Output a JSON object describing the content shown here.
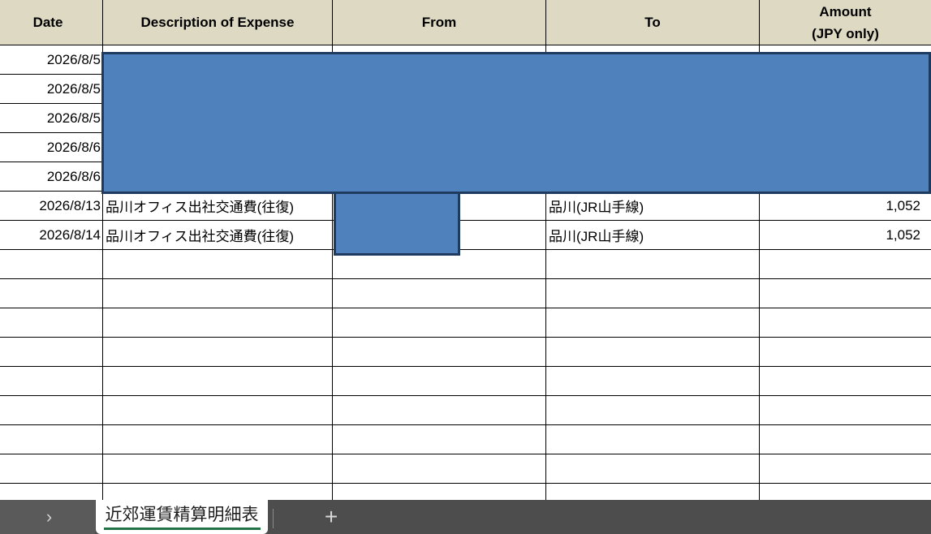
{
  "table": {
    "headers": {
      "date": "Date",
      "description": "Description of Expense",
      "from": "From",
      "to": "To",
      "amount_line1": "Amount",
      "amount_line2": "(JPY only)"
    },
    "rows": [
      {
        "date": "2026/8/5",
        "description": "",
        "from": "",
        "to": "",
        "amount": ""
      },
      {
        "date": "2026/8/5",
        "description": "",
        "from": "",
        "to": "",
        "amount": ""
      },
      {
        "date": "2026/8/5",
        "description": "",
        "from": "",
        "to": "",
        "amount": ""
      },
      {
        "date": "2026/8/6",
        "description": "",
        "from": "",
        "to": "",
        "amount": ""
      },
      {
        "date": "2026/8/6",
        "description": "",
        "from": "",
        "to": "",
        "amount": ""
      },
      {
        "date": "2026/8/13",
        "description": "品川オフィス出社交通費(往復)",
        "from": "",
        "to": "品川(JR山手線)",
        "amount": "1,052"
      },
      {
        "date": "2026/8/14",
        "description": "品川オフィス出社交通費(往復)",
        "from": "",
        "to": "品川(JR山手線)",
        "amount": "1,052"
      },
      {
        "date": "",
        "description": "",
        "from": "",
        "to": "",
        "amount": ""
      },
      {
        "date": "",
        "description": "",
        "from": "",
        "to": "",
        "amount": ""
      },
      {
        "date": "",
        "description": "",
        "from": "",
        "to": "",
        "amount": ""
      },
      {
        "date": "",
        "description": "",
        "from": "",
        "to": "",
        "amount": ""
      },
      {
        "date": "",
        "description": "",
        "from": "",
        "to": "",
        "amount": ""
      },
      {
        "date": "",
        "description": "",
        "from": "",
        "to": "",
        "amount": ""
      },
      {
        "date": "",
        "description": "",
        "from": "",
        "to": "",
        "amount": ""
      },
      {
        "date": "",
        "description": "",
        "from": "",
        "to": "",
        "amount": ""
      },
      {
        "date": "",
        "description": "",
        "from": "",
        "to": "",
        "amount": ""
      }
    ]
  },
  "redaction": {
    "fill_color": "#4f81bd",
    "border_color": "#1f3a5f"
  },
  "sheet_tabs": {
    "nav_icon": "chevron-right-icon",
    "nav_glyph": "›",
    "active_tab_label": "近郊運賃精算明細表",
    "add_icon": "plus-icon",
    "add_glyph": "+"
  },
  "colors": {
    "header_fill": "#ddd9c3",
    "tab_bar": "#4d4d4d",
    "active_tab_underline": "#217346"
  }
}
